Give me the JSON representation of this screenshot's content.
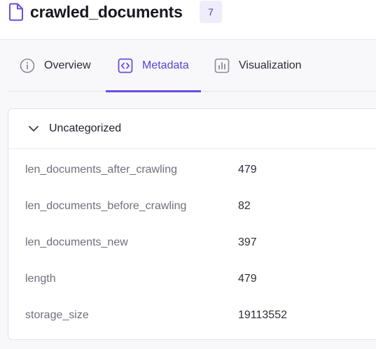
{
  "header": {
    "title": "crawled_documents",
    "count": "7",
    "icon": "file-icon"
  },
  "tabs": [
    {
      "label": "Overview",
      "icon": "info-icon",
      "active": false
    },
    {
      "label": "Metadata",
      "icon": "code-icon",
      "active": true
    },
    {
      "label": "Visualization",
      "icon": "bar-chart-icon",
      "active": false
    }
  ],
  "section": {
    "title": "Uncategorized",
    "expanded": true,
    "rows": [
      {
        "key": "len_documents_after_crawling",
        "value": "479"
      },
      {
        "key": "len_documents_before_crawling",
        "value": "82"
      },
      {
        "key": "len_documents_new",
        "value": "397"
      },
      {
        "key": "length",
        "value": "479"
      },
      {
        "key": "storage_size",
        "value": "19113552"
      }
    ]
  },
  "colors": {
    "accent": "#6a4de0",
    "badge_bg": "#efedfb",
    "badge_text": "#4b3fb0",
    "page_bg": "#f8f8fa"
  }
}
